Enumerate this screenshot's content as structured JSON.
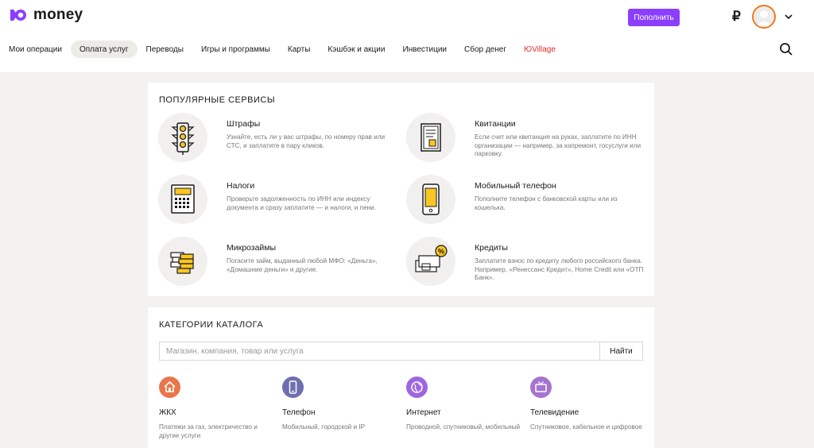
{
  "brand": {
    "name": "money",
    "accent": "#8b3ffd",
    "avatar_ring": "#f07a1f",
    "nav_highlight": "#e02c2c"
  },
  "header": {
    "topup_label": "Пополнить",
    "currency_symbol": "₽",
    "icons": [
      "logo-icon",
      "avatar-icon",
      "chevron-down-icon",
      "search-icon"
    ]
  },
  "nav": {
    "items": [
      {
        "label": "Мои операции"
      },
      {
        "label": "Оплата услуг",
        "active": true
      },
      {
        "label": "Переводы"
      },
      {
        "label": "Игры и программы"
      },
      {
        "label": "Карты"
      },
      {
        "label": "Кэшбэк и акции"
      },
      {
        "label": "Инвестиции"
      },
      {
        "label": "Сбор денег"
      },
      {
        "label": "ЮVillage"
      }
    ]
  },
  "popular": {
    "title": "ПОПУЛЯРНЫЕ СЕРВИСЫ",
    "services": [
      {
        "name": "Штрафы",
        "desc": "Узнайте, есть ли у вас штрафы, по номеру прав или СТС, и заплатите в пару кликов.",
        "icon": "traffic-light-icon"
      },
      {
        "name": "Квитанции",
        "desc": "Если счет или квитанция на руках, заплатите по ИНН организации — например, за капремонт, госуслуги или парковку.",
        "icon": "receipt-icon"
      },
      {
        "name": "Налоги",
        "desc": "Проверьте задолженность по ИНН или индексу документа и сразу заплатите — и налоги, и пени.",
        "icon": "calculator-icon"
      },
      {
        "name": "Мобильный телефон",
        "desc": "Пополните телефон с банковской карты или из кошелька.",
        "icon": "smartphone-icon"
      },
      {
        "name": "Микрозаймы",
        "desc": "Погасите займ, выданный любой МФО: «Деньга», «Домашние деньги» и другие.",
        "icon": "money-stack-icon"
      },
      {
        "name": "Кредиты",
        "desc": "Заплатите взнос по кредиту любого российского банка. Например, «Ренессанс Кредит», Home Credit или «ОТП Банк».",
        "icon": "credit-percent-icon"
      }
    ]
  },
  "catalog": {
    "title": "КАТЕГОРИИ КАТАЛОГА",
    "search_placeholder": "Магазин, компания, товар или услуга",
    "search_button": "Найти",
    "categories": [
      {
        "name": "ЖКХ",
        "desc": "Платежи за газ, электричество и другие услуги",
        "icon": "house-icon",
        "color": "#e8764a"
      },
      {
        "name": "Телефон",
        "desc": "Мобильный, городской и IP",
        "icon": "phone-icon",
        "color": "#6f6fb0"
      },
      {
        "name": "Интернет",
        "desc": "Проводной, спутниковый, мобильный",
        "icon": "globe-icon",
        "color": "#a066e0"
      },
      {
        "name": "Телевидение",
        "desc": "Спутниковое, кабельное и цифровое",
        "icon": "tv-icon",
        "color": "#a574cf"
      }
    ]
  }
}
